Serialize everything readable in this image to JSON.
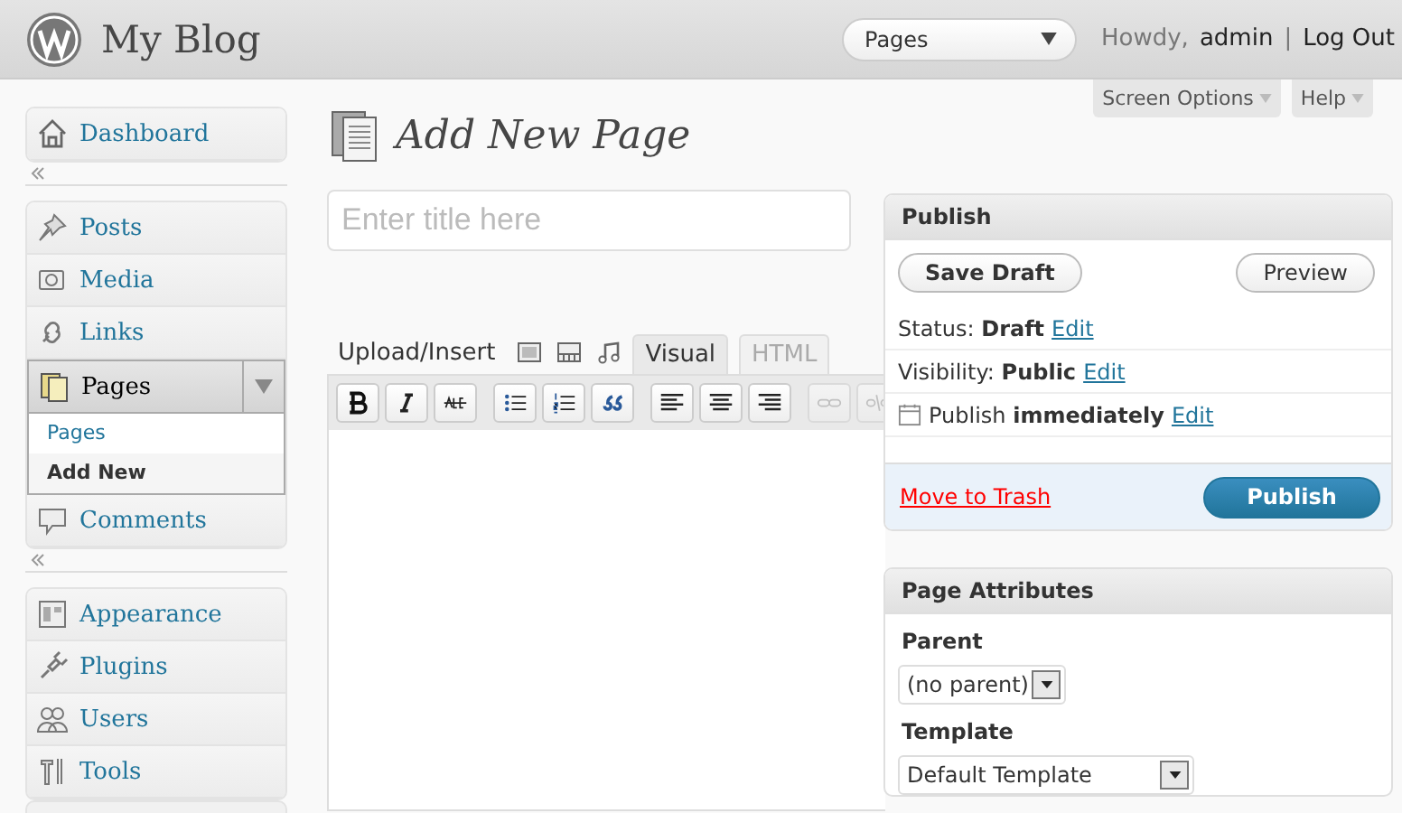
{
  "header": {
    "site_title": "My Blog",
    "quick_menu": {
      "value": "Pages"
    },
    "greeting": "Howdy,",
    "user": "admin",
    "separator": "|",
    "logout": "Log Out"
  },
  "screen_meta": [
    "Screen Options",
    "Help"
  ],
  "sidebar": {
    "groups": [
      [
        {
          "label": "Dashboard",
          "current": false
        }
      ],
      [
        {
          "label": "Posts",
          "current": false
        },
        {
          "label": "Media",
          "current": false
        },
        {
          "label": "Links",
          "current": false
        },
        {
          "label": "Pages",
          "current": true,
          "expanded": true,
          "children": [
            {
              "label": "Pages",
              "selected": false
            },
            {
              "label": "Add New",
              "selected": true
            }
          ]
        },
        {
          "label": "Comments",
          "current": false
        }
      ],
      [
        {
          "label": "Appearance",
          "current": false
        },
        {
          "label": "Plugins",
          "current": false
        },
        {
          "label": "Users",
          "current": false
        },
        {
          "label": "Tools",
          "current": false
        }
      ]
    ]
  },
  "page_title": "Add New Page",
  "title_field": {
    "placeholder": "Enter title here"
  },
  "editor": {
    "media_label": "Upload/Insert",
    "tabs": [
      {
        "label": "Visual",
        "selected": true
      },
      {
        "label": "HTML",
        "selected": false
      }
    ],
    "toolbar": [
      {
        "kind": "bold",
        "disabled": false
      },
      {
        "kind": "italic",
        "disabled": false
      },
      {
        "kind": "strike",
        "disabled": false
      },
      {
        "kind": "sep"
      },
      {
        "kind": "bullets",
        "disabled": false
      },
      {
        "kind": "numbers",
        "disabled": false
      },
      {
        "kind": "quote",
        "disabled": false
      },
      {
        "kind": "sep"
      },
      {
        "kind": "align-left",
        "disabled": false
      },
      {
        "kind": "align-center",
        "disabled": false
      },
      {
        "kind": "align-right",
        "disabled": false
      },
      {
        "kind": "sep"
      },
      {
        "kind": "link",
        "disabled": true
      },
      {
        "kind": "unlink",
        "disabled": true
      }
    ]
  },
  "publish": {
    "title": "Publish",
    "save_draft": "Save Draft",
    "preview": "Preview",
    "rows": [
      {
        "kind": "text",
        "label": "Status:",
        "value": "Draft",
        "action": "Edit"
      },
      {
        "kind": "text",
        "label": "Visibility:",
        "value": "Public",
        "action": "Edit"
      },
      {
        "kind": "calendar",
        "label": "Publish",
        "value": "immediately",
        "action": "Edit"
      }
    ],
    "trash": "Move to Trash",
    "publish_button": "Publish"
  },
  "page_attributes": {
    "title": "Page Attributes",
    "parent_label": "Parent",
    "parent": "(no parent)",
    "template_label": "Template",
    "template": "Default Template"
  }
}
